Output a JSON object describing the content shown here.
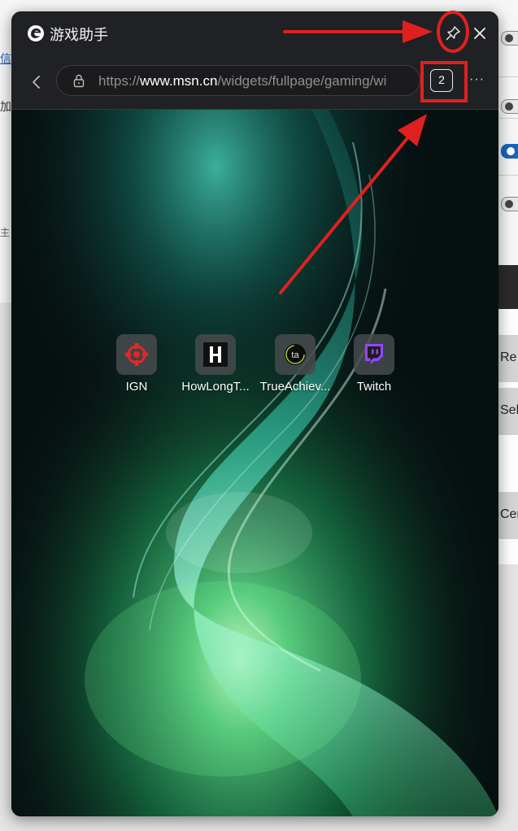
{
  "window": {
    "title": "游戏助手",
    "pin_icon": "pin-icon",
    "close_icon": "close-icon"
  },
  "address_bar": {
    "url_prefix": "https://",
    "url_domain": "www.msn.cn",
    "url_path": "/widgets/fullpage/gaming/wi",
    "tab_count": "2",
    "more_label": "···"
  },
  "shortcuts": [
    {
      "label": "IGN",
      "icon": "ign-icon"
    },
    {
      "label": "HowLongT...",
      "icon": "howlongtobeat-icon"
    },
    {
      "label": "TrueAchiev...",
      "icon": "trueachievements-icon"
    },
    {
      "label": "Twitch",
      "icon": "twitch-icon"
    }
  ],
  "background_page": {
    "right_buttons": [
      "Re",
      "Sel",
      "Cer"
    ],
    "left_texts": [
      "信",
      "加",
      "主"
    ]
  },
  "colors": {
    "annotation_red": "#e02020",
    "panel_bg": "#202124",
    "twitch_purple": "#9146ff",
    "ign_red": "#e3262b"
  }
}
